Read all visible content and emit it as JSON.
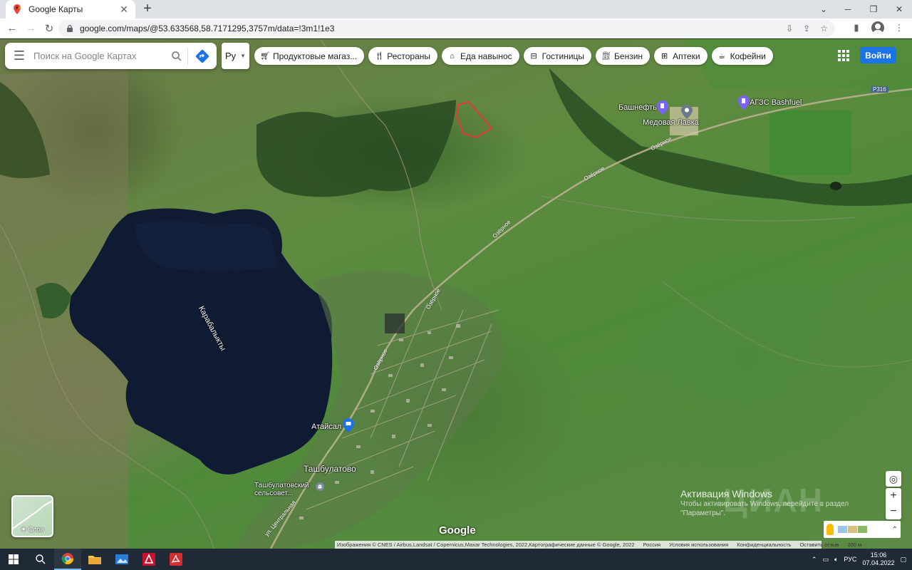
{
  "browser": {
    "tab_title": "Google Карты",
    "url": "google.com/maps/@53.633568,58.7171295,3757m/data=!3m1!1e3"
  },
  "maps": {
    "search_placeholder": "Поиск на Google Картах",
    "lang_label": "Ру",
    "chips": [
      {
        "icon": "shopping-cart-icon",
        "label": "Продуктовые магаз..."
      },
      {
        "icon": "restaurant-icon",
        "label": "Рестораны"
      },
      {
        "icon": "takeout-icon",
        "label": "Еда навынос"
      },
      {
        "icon": "hotel-icon",
        "label": "Гостиницы"
      },
      {
        "icon": "gas-station-icon",
        "label": "Бензин"
      },
      {
        "icon": "pharmacy-icon",
        "label": "Аптеки"
      },
      {
        "icon": "coffee-icon",
        "label": "Кофейни"
      }
    ],
    "signin_label": "Войти",
    "layers_label": "Слои",
    "google_logo": "Google",
    "place_labels": {
      "lake": "Карабалыкты",
      "village": "Ташбулатово",
      "council_line1": "Ташбулатовский",
      "council_line2": "сельсовет...",
      "store": "Атайсал",
      "bashneft": "Башнефть",
      "medovaya": "Медовая Лавка",
      "agzs": "АГЗС Bashfuel",
      "route": "Р316",
      "street1": "Озёрное",
      "street2": "Озёрное",
      "street3": "Озёрное",
      "street4": "Озёрное",
      "street5": "Озёрное",
      "street_central": "ул. Центральная"
    },
    "watermarks": {
      "activate_title": "Активация Windows",
      "activate_line1": "Чтобы активировать Windows, перейдите в раздел",
      "activate_line2": "\"Параметры\".",
      "cian": "ЦИАН"
    },
    "attribution": {
      "imagery": "Изображения © CNES / Airbus,Landsat / Copernicus,Maxar Technologies, 2022,Картографические данные © Google, 2022",
      "country": "Россия",
      "terms": "Условия использования",
      "privacy": "Конфиденциальность",
      "feedback": "Оставить отзыв",
      "scale": "200 м"
    }
  },
  "taskbar": {
    "lang": "РУС",
    "time": "15:06",
    "date": "07.04.2022"
  }
}
